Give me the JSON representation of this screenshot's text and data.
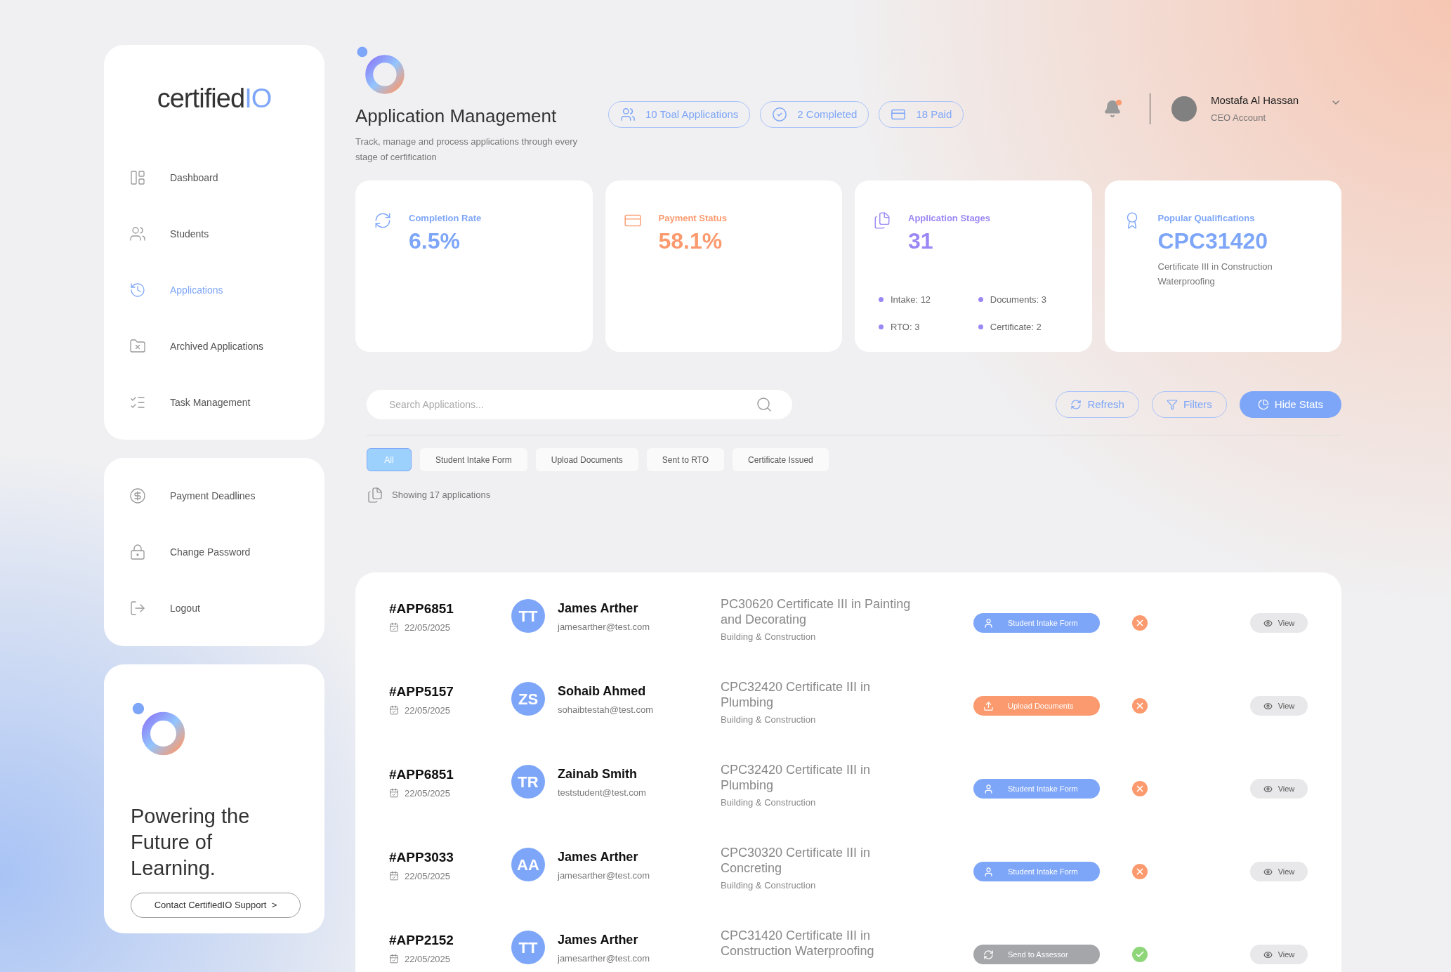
{
  "sidebar": {
    "logo": {
      "word": "certified",
      "mark": "IO"
    },
    "nav": [
      {
        "label": "Dashboard",
        "kind": "dashboard",
        "selected": false
      },
      {
        "label": "Students",
        "kind": "students",
        "selected": false
      },
      {
        "label": "Applications",
        "kind": "applications",
        "selected": true
      },
      {
        "label": "Archived Applications",
        "kind": "archive",
        "selected": false
      },
      {
        "label": "Task Management",
        "kind": "tasks",
        "selected": false
      }
    ],
    "account_nav": [
      {
        "label": "Payment Deadlines",
        "kind": "payment"
      },
      {
        "label": "Change Password",
        "kind": "lock"
      },
      {
        "label": "Logout",
        "kind": "logout"
      }
    ],
    "promo": {
      "headline": "Powering the Future of Learning.",
      "button": "Contact CertifiedIO Support  >"
    }
  },
  "header": {
    "title": "Application Management",
    "subtitle": "Track, manage and process applications through every stage of cerfification",
    "pills": [
      {
        "label": "10 Toal Applications",
        "kind": "people"
      },
      {
        "label": "2 Completed",
        "kind": "check"
      },
      {
        "label": "18 Paid",
        "kind": "card"
      }
    ],
    "notifications": {
      "unread": true
    },
    "user": {
      "name": "Mostafa Al Hassan",
      "role": "CEO Account"
    }
  },
  "stats": [
    {
      "kind": "rate",
      "title": "Completion Rate",
      "value": "6.5%",
      "color": "#7ea6f8"
    },
    {
      "kind": "payment",
      "title": "Payment Status",
      "value": "58.1%",
      "color": "#fb9a6e"
    },
    {
      "kind": "stages",
      "title": "Application Stages",
      "value": "31",
      "color": "#9b87f5",
      "breakdown": [
        "Intake: 12",
        "Documents: 3",
        "RTO: 3",
        "Certificate: 2"
      ]
    },
    {
      "kind": "qualification",
      "title": "Popular Qualifications",
      "value": "CPC31420",
      "color": "#7ea6f8",
      "detail": "Certificate III in Construction Waterproofing"
    }
  ],
  "toolbar": {
    "search": {
      "placeholder": "Search Applications..."
    },
    "buttons": [
      {
        "label": "Refresh",
        "kind": "refresh"
      },
      {
        "label": "Filters",
        "kind": "filter"
      },
      {
        "label": "Hide Stats",
        "kind": "stats"
      }
    ]
  },
  "tabs": [
    {
      "label": "All",
      "selected": true
    },
    {
      "label": "Student Intake Form",
      "selected": false
    },
    {
      "label": "Upload Documents",
      "selected": false
    },
    {
      "label": "Sent to RTO",
      "selected": false
    },
    {
      "label": "Certificate Issued",
      "selected": false
    }
  ],
  "count_text": "Showing 17 applications",
  "applications": [
    {
      "id": "#APP6851",
      "date": "22/05/2025",
      "initials": "TT",
      "name": "James Arther",
      "email": "jamesarther@test.com",
      "qualification": "PC30620 Certificate III in Painting and Decorating",
      "category": "Building & Construction",
      "stage": {
        "label": "Student Intake Form",
        "kind": "intake"
      },
      "approved": false,
      "action": "View"
    },
    {
      "id": "#APP5157",
      "date": "22/05/2025",
      "initials": "ZS",
      "name": "Sohaib Ahmed",
      "email": "sohaibtestah@test.com",
      "qualification": "CPC32420 Certificate III in Plumbing",
      "category": "Building & Construction",
      "stage": {
        "label": "Upload Documents",
        "kind": "upload"
      },
      "approved": false,
      "action": "View"
    },
    {
      "id": "#APP6851",
      "date": "22/05/2025",
      "initials": "TR",
      "name": "Zainab Smith",
      "email": "teststudent@test.com",
      "qualification": "CPC32420 Certificate III in Plumbing",
      "category": "Building & Construction",
      "stage": {
        "label": "Student Intake Form",
        "kind": "intake"
      },
      "approved": false,
      "action": "View"
    },
    {
      "id": "#APP3033",
      "date": "22/05/2025",
      "initials": "AA",
      "name": "James Arther",
      "email": "jamesarther@test.com",
      "qualification": "CPC30320 Certificate III in Concreting",
      "category": "Building & Construction",
      "stage": {
        "label": "Student Intake Form",
        "kind": "intake"
      },
      "approved": false,
      "action": "View"
    },
    {
      "id": "#APP2152",
      "date": "22/05/2025",
      "initials": "TT",
      "name": "James Arther",
      "email": "jamesarther@test.com",
      "qualification": "CPC31420 Certificate III in Construction Waterproofing",
      "stage": {
        "label": "Send to Assessor",
        "kind": "assessor"
      },
      "approved": true,
      "action": "View"
    }
  ]
}
